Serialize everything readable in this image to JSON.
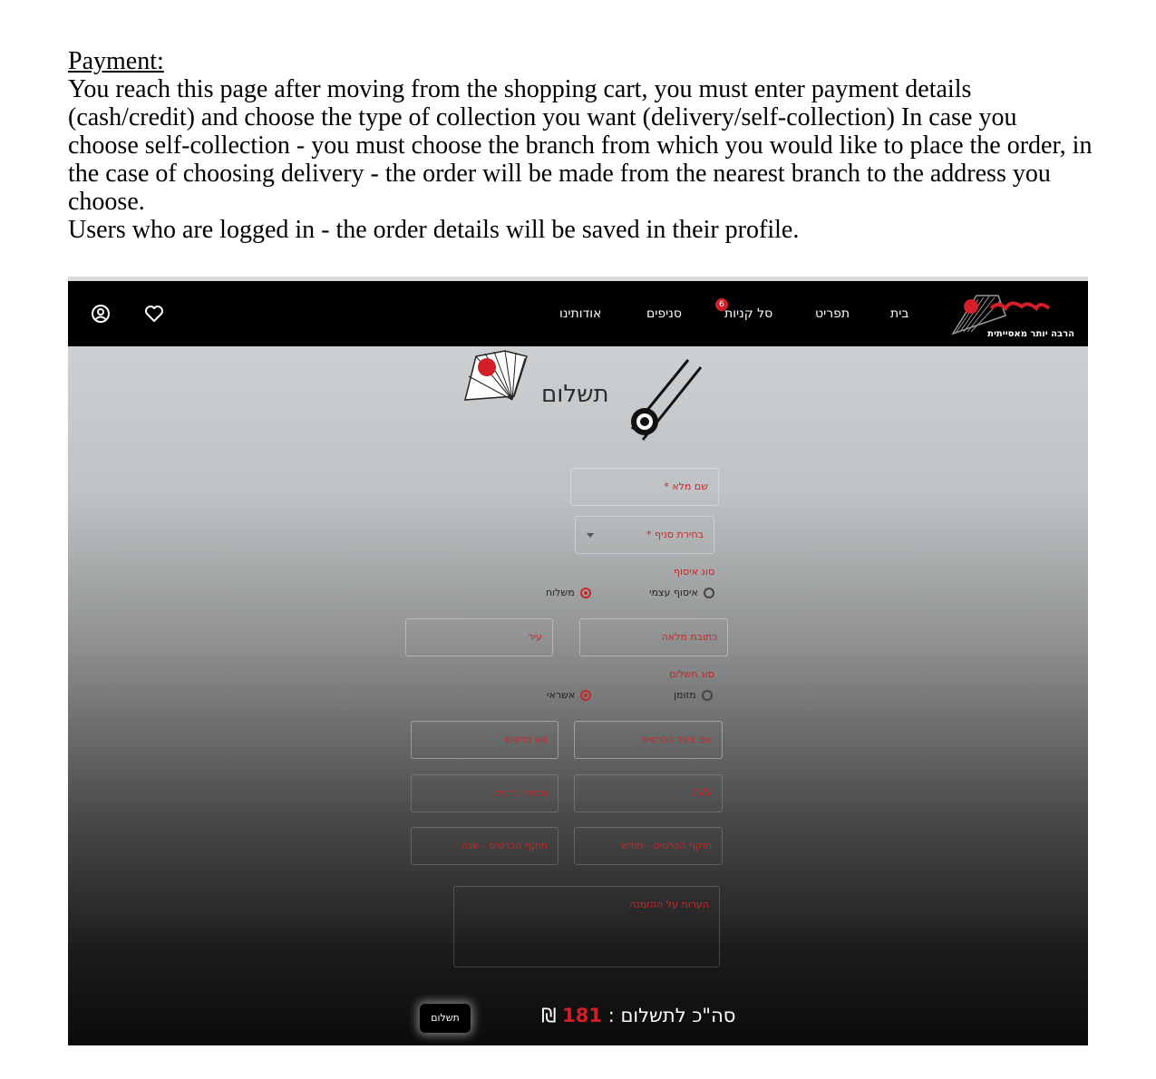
{
  "document": {
    "heading": "Payment:",
    "paragraph1": "You reach this page after moving from the shopping cart, you must enter payment details (cash/credit) and choose the type of collection you want (delivery/self-collection) In case you choose self-collection - you must choose the branch from which you would like to place the order, in the case of choosing delivery - the order will be made from the nearest branch to the address you choose.",
    "paragraph2": "Users who are logged in - the order details will be saved in their profile."
  },
  "navbar": {
    "logo_tagline": "הרבה יותר מאסייתית",
    "links": [
      "בית",
      "תפריט",
      "סל קניות",
      "סניפים",
      "אודותינו"
    ],
    "cart_badge": "6",
    "icons": [
      "user-icon",
      "heart-icon"
    ]
  },
  "page": {
    "title": "תשלום"
  },
  "form": {
    "full_name": "שם מלא *",
    "branch_select": "בחירת סניף *",
    "collection_label": "סוג איסוף",
    "collection_options": [
      "איסוף עצמי",
      "משלוח"
    ],
    "collection_selected": "משלוח",
    "address": "כתובת מלאה",
    "city": "עיר",
    "payment_label": "סוג תשלום",
    "payment_options": [
      "מזומן",
      "אשראי"
    ],
    "payment_selected": "אשראי",
    "card_holder": "שם בעל הכרטיס",
    "card_type": "סוג כרטיס",
    "cvv": "CVV",
    "card_number": "מספר כרטיס",
    "expiry_month": "תוקף הכרטיס - חודש",
    "expiry_year": "תוקף הכרטיס - שנה",
    "notes": "הערות על ההזמנה"
  },
  "summary": {
    "total_label": "סה\"כ לתשלום :",
    "total_amount": "181",
    "currency": "₪",
    "pay_button": "תשלום"
  },
  "colors": {
    "accent": "#d21f2a",
    "navbar_bg": "#000000"
  }
}
